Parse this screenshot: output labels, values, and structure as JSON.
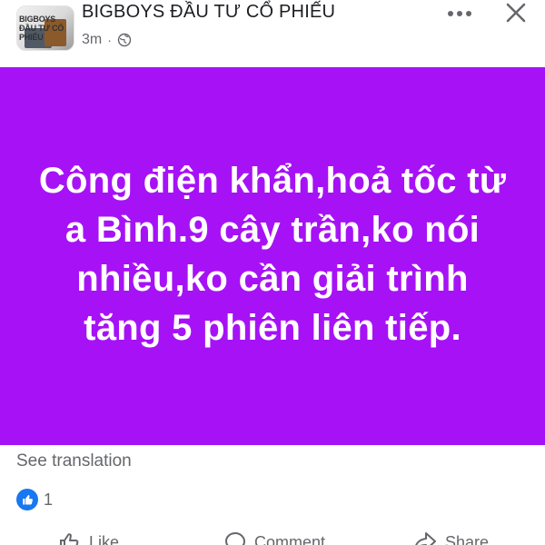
{
  "header": {
    "page_name": "BIGBOYS ĐẦU TƯ CỔ PHIẾU",
    "time": "3m",
    "separator": "·",
    "privacy_icon": "globe-icon",
    "more_icon": "more-horizontal-icon",
    "close_icon": "close-icon",
    "avatar_text": "BIGBOYS ĐẦU TƯ CỔ PHIẾU"
  },
  "post": {
    "background_color": "#a612f5",
    "text_color": "#ffffff",
    "text": "Công điện khẩn,hoả tốc từ a Bình.9 cây trần,ko nói nhiều,ko cần giải trình tăng 5 phiên liên tiếp."
  },
  "translation": {
    "label": "See translation"
  },
  "reactions": {
    "icon": "like-reaction-icon",
    "count": "1",
    "color": "#1877f2"
  },
  "actions": {
    "like_label": "Like",
    "comment_label": "Comment",
    "share_label": "Share"
  }
}
